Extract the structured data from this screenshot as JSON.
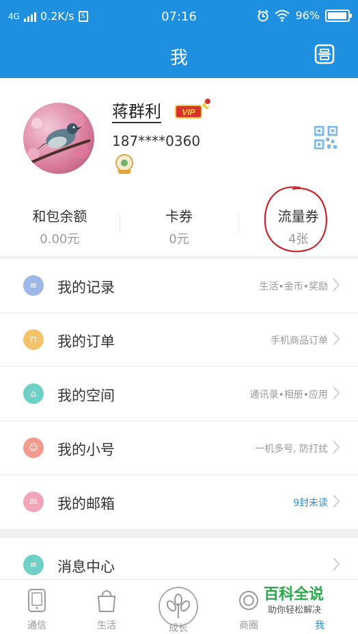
{
  "status_bar": {
    "network": "4G",
    "speed": "0.2K/s",
    "sim": "S",
    "time": "07:16",
    "battery": "96%",
    "battery_level": 0.96
  },
  "header": {
    "title": "我"
  },
  "profile": {
    "name": "蒋群利",
    "phone": "187****0360",
    "vip_text": "VIP"
  },
  "balances": [
    {
      "label": "和包余额",
      "value": "0.00元"
    },
    {
      "label": "卡券",
      "value": "0元"
    },
    {
      "label": "流量券",
      "value": "4张"
    }
  ],
  "menu": [
    {
      "label": "我的记录",
      "hint": "生活•金币•奖励",
      "color": "#9db8e6"
    },
    {
      "label": "我的订单",
      "hint": "手机商品订单",
      "color": "#f2c36b"
    },
    {
      "label": "我的空间",
      "hint": "通讯录•相册•应用",
      "color": "#6fd0c6"
    },
    {
      "label": "我的小号",
      "hint": "一机多号, 防打扰",
      "color": "#f29a8e"
    },
    {
      "label": "我的邮箱",
      "hint": "9封未读",
      "color": "#f0a6b8"
    }
  ],
  "menu2": [
    {
      "label": "消息中心",
      "color": "#6fd0c6"
    }
  ],
  "tabs": [
    {
      "label": "通信"
    },
    {
      "label": "生活"
    },
    {
      "label": "成长"
    },
    {
      "label": "商圈"
    },
    {
      "label": "我"
    }
  ],
  "watermark": {
    "title": "百科全说",
    "subtitle": "助你轻松解决"
  },
  "colors": {
    "brand_blue": "#1f8fe0",
    "circle_red": "#c8242a"
  }
}
